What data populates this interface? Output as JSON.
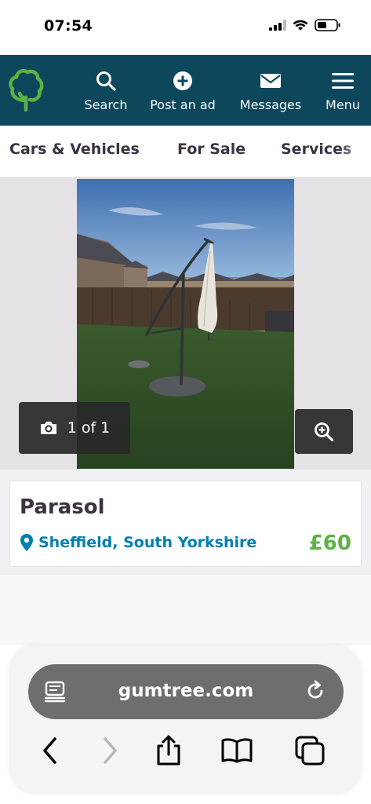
{
  "status_bar": {
    "time": "07:54"
  },
  "header": {
    "logo": "gumtree-tree-logo",
    "nav": [
      {
        "label": "Search",
        "icon": "search-icon"
      },
      {
        "label": "Post an ad",
        "icon": "plus-circle-icon"
      },
      {
        "label": "Messages",
        "icon": "envelope-icon"
      },
      {
        "label": "Menu",
        "icon": "hamburger-icon"
      }
    ],
    "colors": {
      "background": "#0d475c",
      "logo": "#5cb145"
    }
  },
  "categories": [
    "Cars & Vehicles",
    "For Sale",
    "Services"
  ],
  "gallery": {
    "counter": "1 of 1",
    "counter_icon": "camera-icon",
    "zoom_icon": "zoom-in-icon"
  },
  "listing": {
    "title": "Parasol",
    "location": "Sheffield, South Yorkshire",
    "price": "£60",
    "colors": {
      "location": "#007fb0",
      "price": "#5cb145"
    }
  },
  "browser": {
    "url": "gumtree.com",
    "toolbar": [
      "back-icon",
      "forward-icon",
      "share-icon",
      "bookmarks-icon",
      "tabs-icon"
    ]
  }
}
